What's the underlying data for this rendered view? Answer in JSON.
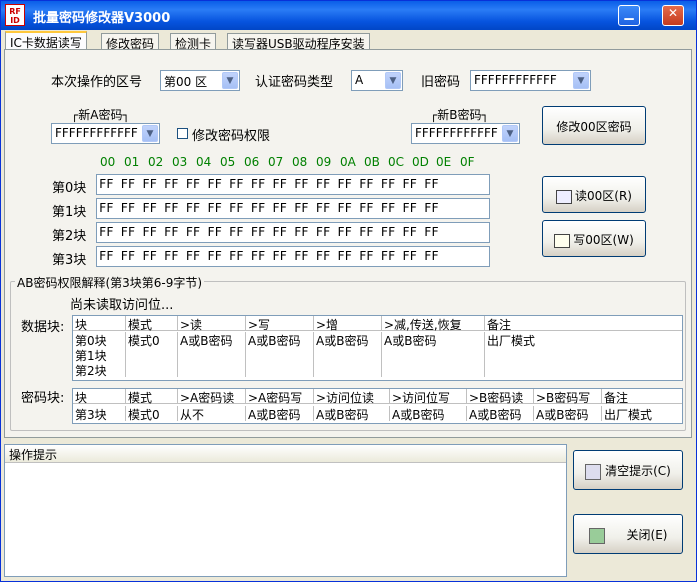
{
  "window": {
    "title": "批量密码修改器V3000",
    "icon_text": "RF ID"
  },
  "tabs": [
    "IC卡数据读写",
    "修改密码",
    "检测卡",
    "读写器USB驱动程序安装"
  ],
  "form": {
    "sector_label": "本次操作的区号",
    "sector_value": "第00 区",
    "auth_label": "认证密码类型",
    "auth_value": "A",
    "oldpwd_label": "旧密码",
    "oldpwd_value": "FFFFFFFFFFFF",
    "newA_label": "新A密码",
    "newA_value": "FFFFFFFFFFFF",
    "modify_perm_label": "修改密码权限",
    "newB_label": "新B密码",
    "newB_value": "FFFFFFFFFFFF"
  },
  "buttons": {
    "modify": "修改00区密码",
    "read": "读00区(R)",
    "write": "写00区(W)",
    "clear": "清空提示(C)",
    "close": "关闭(E)"
  },
  "hex_header": [
    "00",
    "01",
    "02",
    "03",
    "04",
    "05",
    "06",
    "07",
    "08",
    "09",
    "0A",
    "0B",
    "0C",
    "0D",
    "0E",
    "0F"
  ],
  "blocks": [
    {
      "label": "第0块",
      "data": "FF FF FF FF FF FF FF FF FF FF FF FF FF FF FF FF"
    },
    {
      "label": "第1块",
      "data": "FF FF FF FF FF FF FF FF FF FF FF FF FF FF FF FF"
    },
    {
      "label": "第2块",
      "data": "FF FF FF FF FF FF FF FF FF FF FF FF FF FF FF FF"
    },
    {
      "label": "第3块",
      "data": "FF FF FF FF FF FF FF FF FF FF FF FF FF FF FF FF"
    }
  ],
  "perm": {
    "group_title": "AB密码权限解释(第3块第6-9字节)",
    "status": "尚未读取访问位...",
    "data_label": "数据块:",
    "data_headers": [
      "块",
      "模式",
      ">读",
      ">写",
      ">增",
      ">减,传送,恢复",
      "备注"
    ],
    "data_rows": [
      [
        "第0块",
        "模式0",
        "A或B密码",
        "A或B密码",
        "A或B密码",
        "A或B密码",
        "出厂模式"
      ],
      [
        "第1块",
        "",
        "",
        "",
        "",
        "",
        ""
      ],
      [
        "第2块",
        "",
        "",
        "",
        "",
        "",
        ""
      ]
    ],
    "pwd_label": "密码块:",
    "pwd_headers": [
      "块",
      "模式",
      ">A密码读",
      ">A密码写",
      ">访问位读",
      ">访问位写",
      ">B密码读",
      ">B密码写",
      "备注"
    ],
    "pwd_rows": [
      [
        "第3块",
        "模式0",
        "从不",
        "A或B密码",
        "A或B密码",
        "A或B密码",
        "A或B密码",
        "A或B密码",
        "出厂模式"
      ]
    ]
  },
  "log": {
    "header": "操作提示"
  }
}
